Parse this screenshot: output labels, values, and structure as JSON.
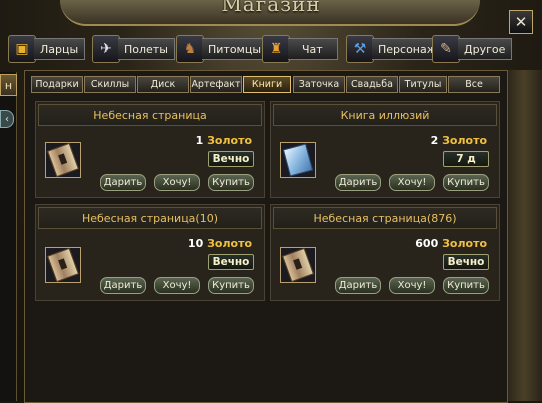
{
  "window": {
    "title": "Магазин"
  },
  "left": {
    "tab_label": "н",
    "knob_label": "‹"
  },
  "categories": [
    {
      "label": "Ларцы",
      "icon": "chest-icon"
    },
    {
      "label": "Полеты",
      "icon": "wing-icon"
    },
    {
      "label": "Питомцы",
      "icon": "pet-icon"
    },
    {
      "label": "Чат",
      "icon": "chat-icon"
    },
    {
      "label": "Персонаж",
      "icon": "character-icon"
    },
    {
      "label": "Другое",
      "icon": "scroll-icon"
    }
  ],
  "subtabs": [
    "Подарки",
    "Скиллы",
    "Диск",
    "Артефакт",
    "Книги",
    "Заточка",
    "Свадьба",
    "Титулы",
    "Все"
  ],
  "active_subtab": "Книги",
  "items": [
    {
      "name": "Небесная страница",
      "amount": "1",
      "currency": "Золото",
      "duration": "Вечно",
      "icon": "scroll-icon"
    },
    {
      "name": "Книга иллюзий",
      "amount": "2",
      "currency": "Золото",
      "duration": "7 д",
      "icon": "book-icon"
    },
    {
      "name": "Небесная страница(10)",
      "amount": "10",
      "currency": "Золото",
      "duration": "Вечно",
      "icon": "scroll-icon"
    },
    {
      "name": "Небесная страница(876)",
      "amount": "600",
      "currency": "Золото",
      "duration": "Вечно",
      "icon": "scroll-icon"
    }
  ],
  "buttons": {
    "gift": "Дарить",
    "want": "Хочу!",
    "buy": "Купить"
  },
  "close_symbol": "✕",
  "colors": {
    "gold": "#f0c040",
    "title_gold": "#e8c060",
    "active_tab": "#e0c070"
  }
}
